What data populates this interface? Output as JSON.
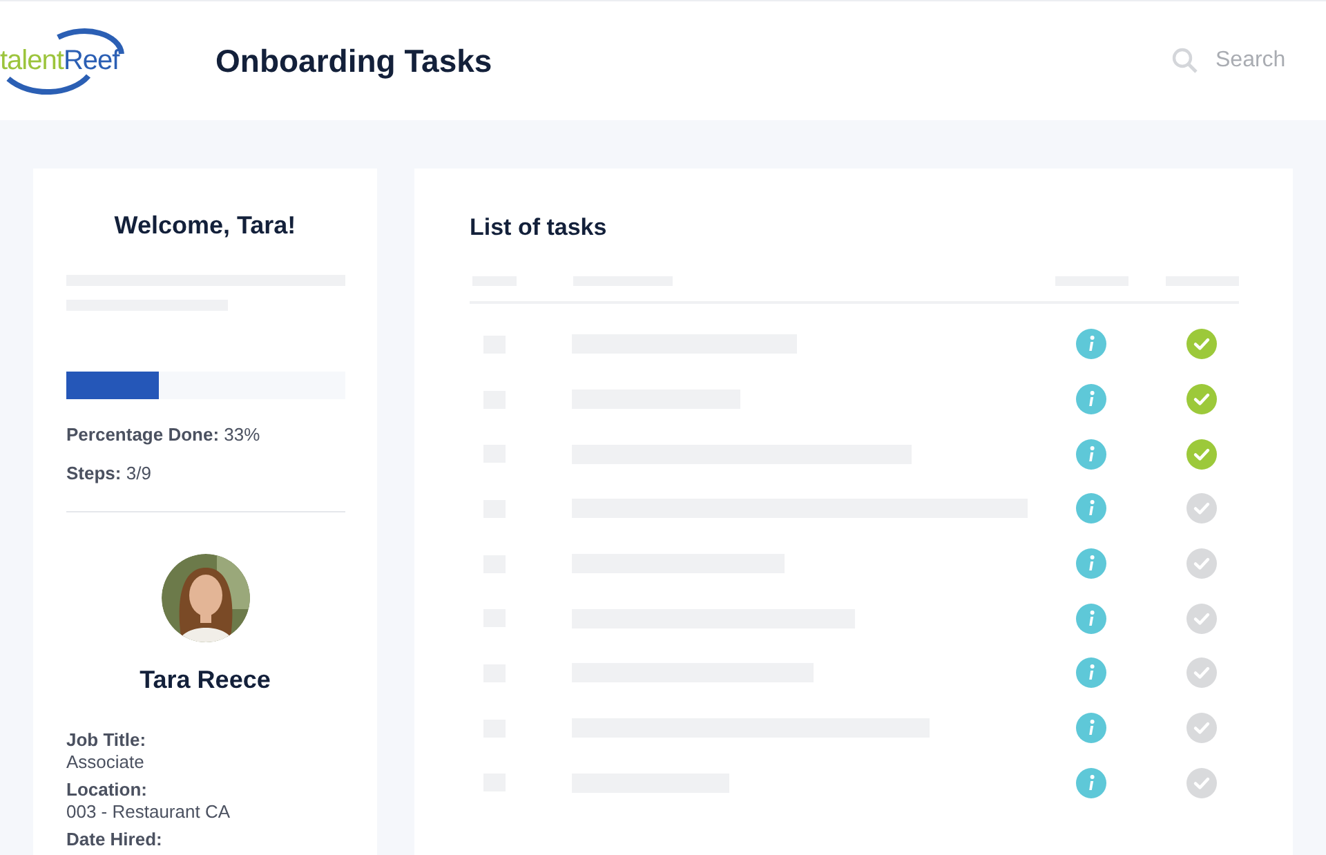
{
  "header": {
    "logo": {
      "part_1": "talent",
      "part_2": "Reef"
    },
    "title": "Onboarding Tasks",
    "search": {
      "placeholder": "Search"
    }
  },
  "profile_card": {
    "welcome": "Welcome, Tara!",
    "progress": {
      "level": 0.33
    },
    "percentage": {
      "label": "Percentage Done:",
      "value": "33%"
    },
    "steps": {
      "label": "Steps:",
      "value": "3/9"
    },
    "name": "Tara Reece",
    "details": [
      {
        "label": "Job Title:",
        "value": "Associate"
      },
      {
        "label": "Location:",
        "value": "003 - Restaurant CA"
      },
      {
        "label": "Date Hired:"
      }
    ]
  },
  "task_list": {
    "title": "List of tasks",
    "tasks": [
      {
        "done": true
      },
      {
        "done": true
      },
      {
        "done": true
      },
      {
        "done": false
      },
      {
        "done": false
      },
      {
        "done": false
      },
      {
        "done": false
      },
      {
        "done": false
      },
      {
        "done": false
      }
    ]
  }
}
